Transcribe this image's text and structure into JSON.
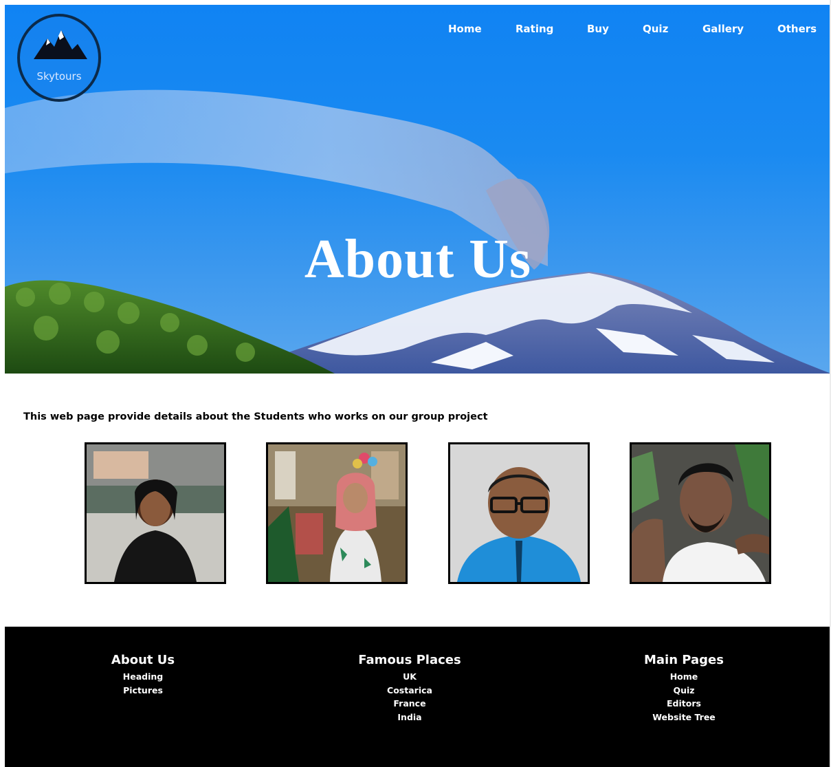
{
  "brand": {
    "name": "Skytours",
    "logo_icon": "mountain-icon"
  },
  "nav": {
    "items": [
      {
        "label": "Home"
      },
      {
        "label": "Rating"
      },
      {
        "label": "Buy"
      },
      {
        "label": "Quiz"
      },
      {
        "label": "Gallery"
      },
      {
        "label": "Others"
      }
    ]
  },
  "hero": {
    "title": "About Us"
  },
  "intro": {
    "text": "This web page provide details about the Students who works on our group project"
  },
  "students": [
    {
      "photo": "student-photo-1"
    },
    {
      "photo": "student-photo-2"
    },
    {
      "photo": "student-photo-3"
    },
    {
      "photo": "student-photo-4"
    }
  ],
  "footer": {
    "columns": [
      {
        "heading": "About Us",
        "links": [
          "Heading",
          "Pictures"
        ]
      },
      {
        "heading": "Famous Places",
        "links": [
          "UK",
          "Costarica",
          "France",
          "India"
        ]
      },
      {
        "heading": "Main Pages",
        "links": [
          "Home",
          "Quiz",
          "Editors",
          "Website Tree"
        ]
      }
    ]
  },
  "colors": {
    "sky": "#1083f3",
    "footer_bg": "#000000",
    "text": "#ffffff"
  }
}
